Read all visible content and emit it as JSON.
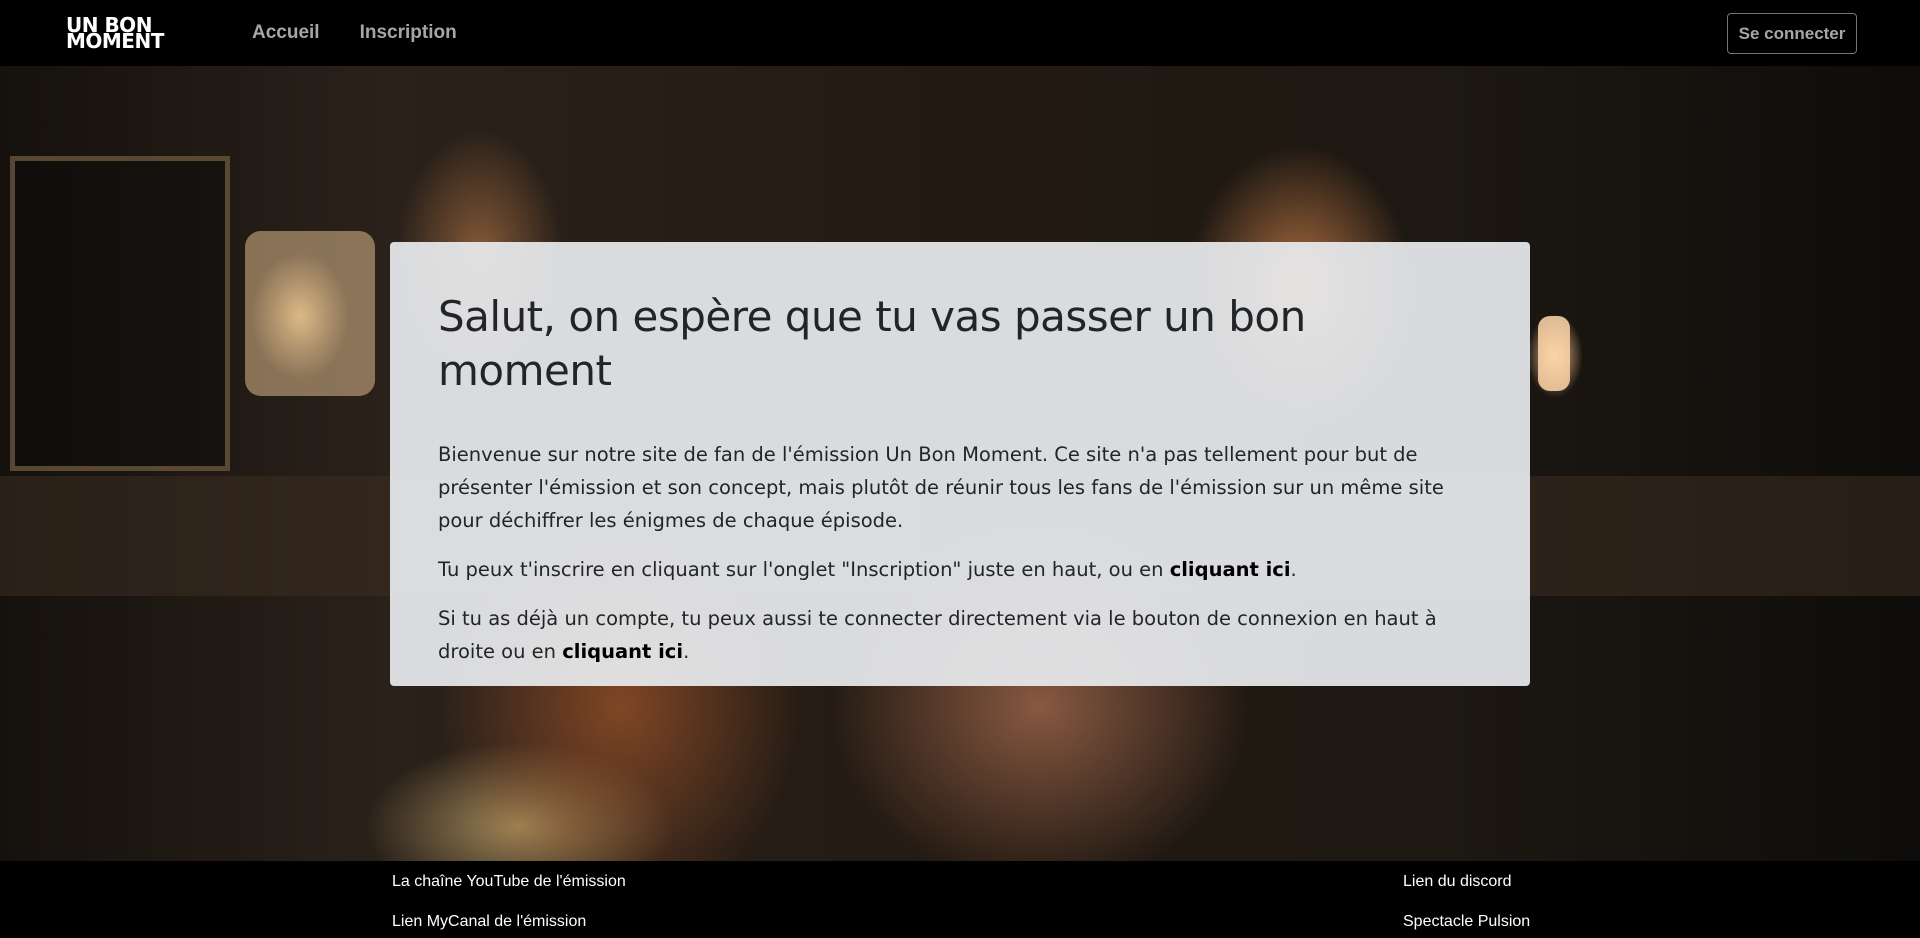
{
  "navbar": {
    "logo_line1": "UN BON",
    "logo_line2": "MOMENT",
    "links": [
      "Accueil",
      "Inscription"
    ],
    "login_button": "Se connecter"
  },
  "card": {
    "title": "Salut, on espère que tu vas passer un bon moment",
    "intro": "Bienvenue sur notre site de fan de l'émission Un Bon Moment. Ce site n'a pas tellement pour but de présenter l'émission et son concept, mais plutôt de réunir tous les fans de l'émission sur un même site pour déchiffrer les énigmes de chaque épisode.",
    "register_text": "Tu peux t'inscrire en cliquant sur l'onglet \"Inscription\" juste en haut, ou en ",
    "register_link": "cliquant ici",
    "register_end": ".",
    "login_text": "Si tu as déjà un compte, tu peux aussi te connecter directement via le bouton de connexion en haut à droite ou en ",
    "login_link": "cliquant ici",
    "login_end": "."
  },
  "footer": {
    "left_links": [
      "La chaîne YouTube de l'émission",
      "Lien MyCanal de l'émission"
    ],
    "right_links": [
      "Lien du discord",
      "Spectacle Pulsion"
    ]
  }
}
